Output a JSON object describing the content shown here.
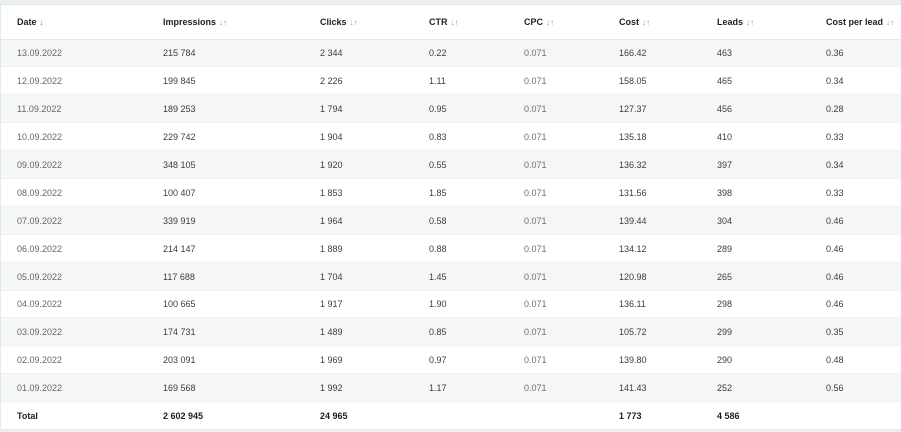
{
  "columns": [
    {
      "label": "Date",
      "sort_icon": "↓",
      "icon_name": "sort-desc-icon",
      "active": true
    },
    {
      "label": "Impressions",
      "sort_icon": "↓↑",
      "icon_name": "sort-icon",
      "active": false
    },
    {
      "label": "Clicks",
      "sort_icon": "↓↑",
      "icon_name": "sort-icon",
      "active": false
    },
    {
      "label": "CTR",
      "sort_icon": "↓↑",
      "icon_name": "sort-icon",
      "active": false
    },
    {
      "label": "CPC",
      "sort_icon": "↓↑",
      "icon_name": "sort-icon",
      "active": false
    },
    {
      "label": "Cost",
      "sort_icon": "↓↑",
      "icon_name": "sort-icon",
      "active": false
    },
    {
      "label": "Leads",
      "sort_icon": "↓↑",
      "icon_name": "sort-icon",
      "active": false
    },
    {
      "label": "Cost per lead",
      "sort_icon": "↓↑",
      "icon_name": "sort-icon",
      "active": false
    }
  ],
  "rows": [
    [
      "13.09.2022",
      "215 784",
      "2 344",
      "0.22",
      "0.071",
      "166.42",
      "463",
      "0.36"
    ],
    [
      "12.09.2022",
      "199 845",
      "2 226",
      "1.11",
      "0.071",
      "158.05",
      "465",
      "0.34"
    ],
    [
      "11.09.2022",
      "189 253",
      "1 794",
      "0.95",
      "0.071",
      "127.37",
      "456",
      "0.28"
    ],
    [
      "10.09.2022",
      "229 742",
      "1 904",
      "0.83",
      "0.071",
      "135.18",
      "410",
      "0.33"
    ],
    [
      "09.09.2022",
      "348 105",
      "1 920",
      "0.55",
      "0.071",
      "136.32",
      "397",
      "0.34"
    ],
    [
      "08.09.2022",
      "100 407",
      "1 853",
      "1.85",
      "0.071",
      "131.56",
      "398",
      "0.33"
    ],
    [
      "07.09.2022",
      "339 919",
      "1 964",
      "0.58",
      "0.071",
      "139.44",
      "304",
      "0.46"
    ],
    [
      "06.09.2022",
      "214 147",
      "1 889",
      "0.88",
      "0.071",
      "134.12",
      "289",
      "0.46"
    ],
    [
      "05.09.2022",
      "117 688",
      "1 704",
      "1.45",
      "0.071",
      "120.98",
      "265",
      "0.46"
    ],
    [
      "04.09.2022",
      "100 665",
      "1 917",
      "1.90",
      "0.071",
      "136.11",
      "298",
      "0.46"
    ],
    [
      "03.09.2022",
      "174 731",
      "1 489",
      "0.85",
      "0.071",
      "105.72",
      "299",
      "0.35"
    ],
    [
      "02.09.2022",
      "203 091",
      "1 969",
      "0.97",
      "0.071",
      "139.80",
      "290",
      "0.48"
    ],
    [
      "01.09.2022",
      "169 568",
      "1 992",
      "1.17",
      "0.071",
      "141.43",
      "252",
      "0.56"
    ]
  ],
  "total": [
    "Total",
    "2 602 945",
    "24 965",
    "",
    "",
    "1 773",
    "4 586",
    ""
  ],
  "colors": {
    "accent": "#23a56b",
    "stripe": "#f5f7f6",
    "page_bg": "#eaf0ed"
  }
}
